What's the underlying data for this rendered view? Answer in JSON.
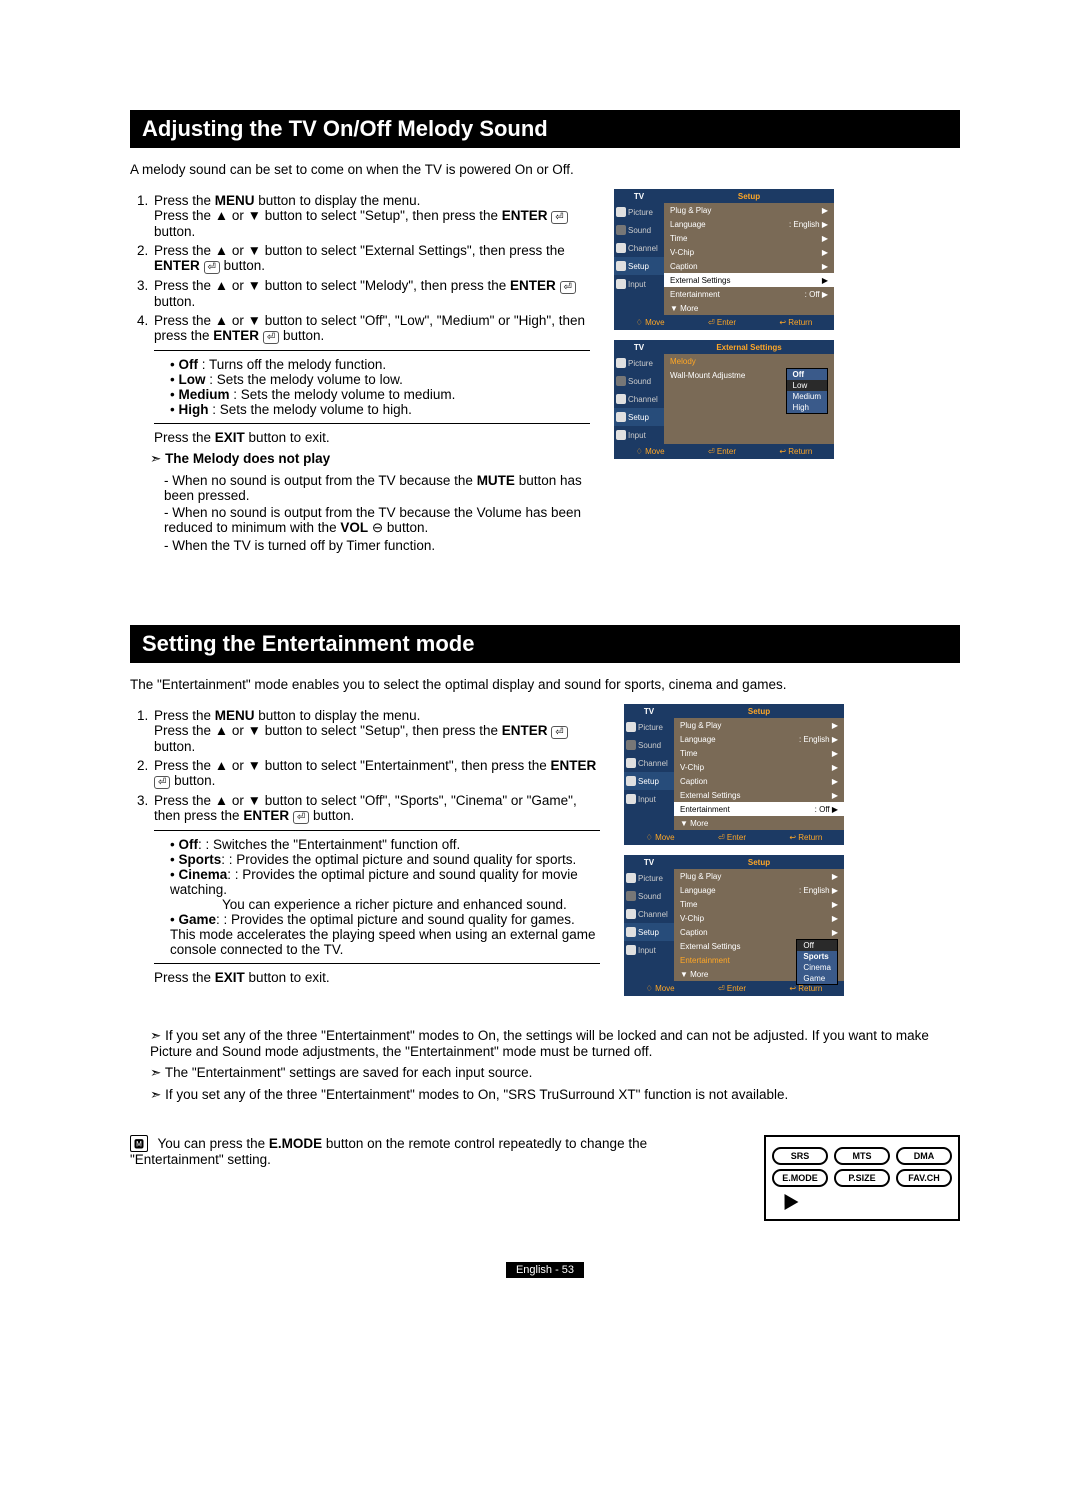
{
  "section1": {
    "title": "Adjusting the TV On/Off Melody Sound",
    "intro": "A melody sound can be set to come on when the TV is powered On or Off.",
    "step1a": "Press the ",
    "menu": "MENU",
    "step1b": " button to display the menu.",
    "step1c": "Press the ▲ or ▼ button to select \"Setup\", then press the ",
    "enter": "ENTER",
    "button_word": " button.",
    "step2": "Press the ▲ or ▼ button to select \"External Settings\", then press the ",
    "step3": "Press the ▲ or ▼ button to select \"Melody\", then press the ",
    "step4a": "Press the ▲ or ▼ button to select \"Off\", \"Low\", \"Medium\" or \"High\", then press the ",
    "off": "Off",
    "off_desc": " : Turns off the melody function.",
    "low": "Low",
    "low_desc": " : Sets the melody volume to low.",
    "medium": "Medium",
    "medium_desc": " : Sets the melody volume to medium.",
    "high": "High",
    "high_desc": " : Sets the melody volume to high.",
    "exit_a": "Press the ",
    "exit": "EXIT",
    "exit_b": " button to exit.",
    "note_title": "The Melody does not play",
    "note1a": "- When no sound is output from the TV because the ",
    "mute": "MUTE",
    "note1b": " button has been pressed.",
    "note2a": "- When no sound is output from the TV because the Volume has been reduced to minimum with the ",
    "vol": "VOL",
    "vol_sym": "⊖",
    "note3": "- When the TV is turned off by Timer function."
  },
  "section2": {
    "title": "Setting the Entertainment mode",
    "intro": "The \"Entertainment\" mode enables you to select the optimal display and sound for sports, cinema and games.",
    "step1a": "Press the ",
    "step1b": " button to display the menu.",
    "step1c": "Press the ▲ or ▼ button to select \"Setup\", then press the ",
    "step2": "Press the ▲ or ▼ button to select \"Entertainment\", then press the ",
    "step3a": "Press the ▲ or ▼ button to select \"Off\", \"Sports\", \"Cinema\" or \"Game\", then press the ",
    "off": "Off",
    "off_desc": ": Switches the \"Entertainment\" function off.",
    "sports": "Sports",
    "sports_desc": ": Provides the optimal picture and sound quality for sports.",
    "cinema": "Cinema",
    "cinema_desc": ": Provides the optimal picture and sound quality for movie watching.",
    "cinema_desc2": "You can experience a richer picture and enhanced sound.",
    "game": "Game",
    "game_desc": ": Provides the optimal picture and sound quality for games. This mode accelerates the playing speed when using an external game console connected to the TV.",
    "exit_a": "Press the ",
    "exit_b": " button to exit.",
    "note1": "If you set any of the three \"Entertainment\" modes to On, the settings will be locked and can not be adjusted. If you want to make Picture and Sound mode adjustments, the \"Entertainment\" mode must be turned off.",
    "note2": "The \"Entertainment\" settings are saved for each input source.",
    "note3": "If you set any of the three \"Entertainment\" modes to On, \"SRS TruSurround XT\" function is not available.",
    "remote_note_a": "You can press the ",
    "emode": "E.MODE",
    "remote_note_b": " button on the remote control repeatedly to change the \"Entertainment\" setting."
  },
  "osd": {
    "tv": "TV",
    "setup": "Setup",
    "extset": "External Settings",
    "side": {
      "picture": "Picture",
      "sound": "Sound",
      "channel": "Channel",
      "setup": "Setup",
      "input": "Input"
    },
    "menu1": {
      "plug": "Plug & Play",
      "lang": "Language",
      "langv": ": English",
      "time": "Time",
      "vchip": "V-Chip",
      "caption": "Caption",
      "ext": "External Settings",
      "ent": "Entertainment",
      "entv": ": Off",
      "more": "▼ More"
    },
    "menu2": {
      "melody": "Melody",
      "wall": "Wall-Mount Adjustme",
      "off": "Off",
      "low": "Low",
      "med": "Medium",
      "high": "High"
    },
    "menu_ent_dd": {
      "off": "Off",
      "sports": "Sports",
      "cinema": "Cinema",
      "game": "Game"
    },
    "bottom": {
      "move": "Move",
      "enter": "Enter",
      "return": "Return"
    }
  },
  "remote": {
    "srs": "SRS",
    "mts": "MTS",
    "dma": "DMA",
    "emode": "E.MODE",
    "psize": "P.SIZE",
    "favch": "FAV.CH"
  },
  "footer": "English - 53",
  "glyph": {
    "updown": "♢",
    "enter": "⏎",
    "return": "↩",
    "icon": "🅼"
  }
}
